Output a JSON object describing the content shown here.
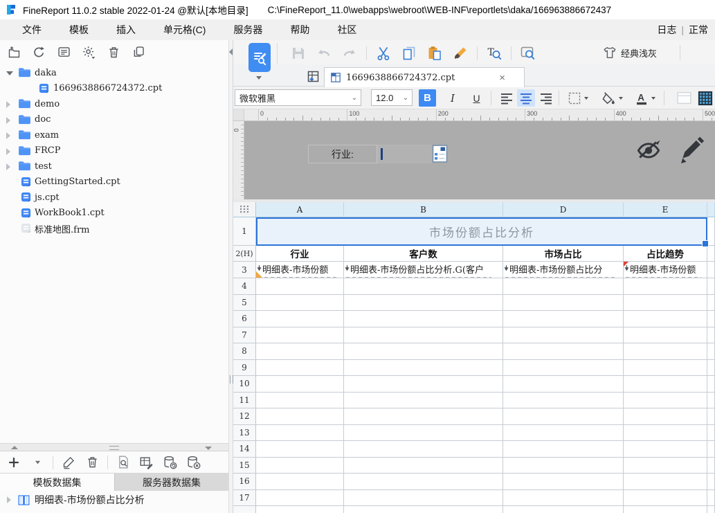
{
  "title_bar": {
    "title": "FineReport 11.0.2 stable 2022-01-24 @默认[本地目录]",
    "path": "C:\\FineReport_11.0\\webapps\\webroot\\WEB-INF\\reportlets\\daka/166963886672437"
  },
  "menu_bar": {
    "items": [
      "文件",
      "模板",
      "插入",
      "单元格(C)",
      "服务器",
      "帮助",
      "社区"
    ],
    "log_label": "日志",
    "divider": "|",
    "status_label": "正常"
  },
  "file_tree": {
    "toolbar_icons": [
      "new-folder",
      "refresh",
      "template-panel",
      "settings-gear",
      "delete",
      "copy-doc"
    ],
    "items": [
      {
        "label": "daka",
        "type": "folder",
        "level": 0,
        "expanded": true
      },
      {
        "label": "1669638866724372.cpt",
        "type": "cpt",
        "level": 1
      },
      {
        "label": "demo",
        "type": "folder",
        "level": 0,
        "expanded": false
      },
      {
        "label": "doc",
        "type": "folder",
        "level": 0,
        "expanded": false
      },
      {
        "label": "exam",
        "type": "folder",
        "level": 0,
        "expanded": false
      },
      {
        "label": "FRCP",
        "type": "folder",
        "level": 0,
        "expanded": false
      },
      {
        "label": "test",
        "type": "folder",
        "level": 0,
        "expanded": false
      },
      {
        "label": "GettingStarted.cpt",
        "type": "cpt",
        "level": 0
      },
      {
        "label": "js.cpt",
        "type": "cpt",
        "level": 0
      },
      {
        "label": "WorkBook1.cpt",
        "type": "cpt",
        "level": 0
      },
      {
        "label": "标准地图.frm",
        "type": "frm",
        "level": 0
      }
    ]
  },
  "dataset_panel": {
    "toolbar_icons": [
      "add",
      "caret",
      "|",
      "edit-pencil",
      "delete",
      "|",
      "preview-doc",
      "edit-table",
      "db-sync",
      "db-disconnect"
    ],
    "tabs": [
      {
        "label": "模板数据集",
        "active": true
      },
      {
        "label": "服务器数据集",
        "active": false
      }
    ],
    "dataset_name": "明细表-市场份额占比分析"
  },
  "editor": {
    "toolbar_icons": [
      "save",
      "undo",
      "redo",
      "|",
      "cut",
      "copy-page",
      "paste",
      "format-painter",
      "|",
      "find-replace",
      "|",
      "preview-zoom"
    ],
    "theme_label": "经典浅灰",
    "tab_title": "1669638866724372.cpt",
    "font_name": "微软雅黑",
    "font_size": "12.0",
    "bold_label": "B",
    "italic_label": "I",
    "underline_label": "U"
  },
  "ruler": {
    "h_ticks": [
      "0",
      "100",
      "200",
      "300",
      "400",
      "500"
    ],
    "v_origin": "0"
  },
  "param_pane": {
    "field_label": "行业:"
  },
  "sheet": {
    "columns": [
      "A",
      "B",
      "D",
      "E"
    ],
    "row_labels": [
      "1",
      "2(H)",
      "3",
      "4",
      "5",
      "6",
      "7",
      "8",
      "9",
      "10",
      "11",
      "12",
      "13",
      "14",
      "15",
      "16",
      "17"
    ],
    "title": "市场份额占比分析",
    "header_cells": [
      "行业",
      "客户数",
      "市场占比",
      "占比趋势"
    ],
    "binding_cells": [
      "明细表-市场份额",
      "明细表-市场份额占比分析.G(客户",
      "明细表-市场份额占比分",
      "明细表-市场份额"
    ]
  }
}
